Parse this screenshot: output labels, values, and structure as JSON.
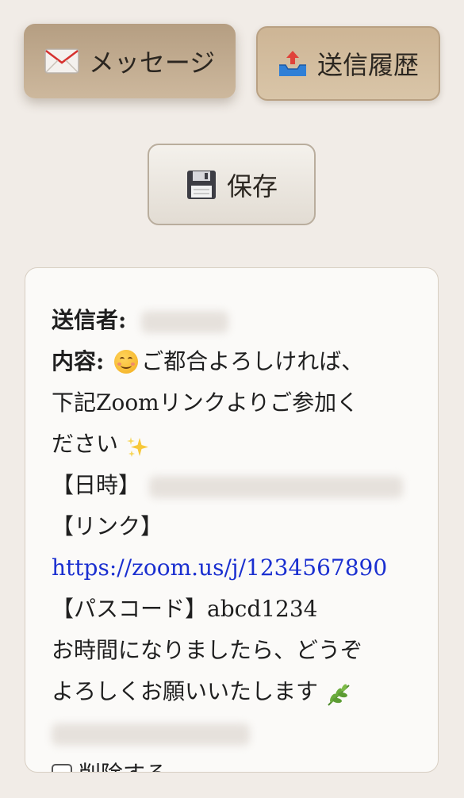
{
  "toolbar": {
    "message_label": "メッセージ",
    "history_label": "送信履歴",
    "save_label": "保存"
  },
  "message": {
    "sender_label": "送信者:",
    "content_label": "内容:",
    "line1": "ご都合よろしければ、",
    "line2": "下記Zoomリンクよりご参加く",
    "line3": "ださい",
    "datetime_label": "【日時】",
    "link_label": "【リンク】",
    "link_url": "https://zoom.us/j/1234567890",
    "passcode_label": "【パスコード】",
    "passcode_value": "abcd1234",
    "closing_line1": "お時間になりましたら、どうぞ",
    "closing_line2": "よろしくお願いいたします"
  },
  "delete": {
    "label": "削除する",
    "checked": false
  },
  "icons": {
    "message": "envelope-icon",
    "history": "outbox-tray-icon",
    "save": "floppy-disk-icon",
    "smile": "smiling-face-emoji",
    "sparkles": "sparkles-emoji",
    "leaf": "herb-emoji"
  },
  "colors": {
    "background": "#f1ece7",
    "message_button": "#c2ab8f",
    "history_button": "#d4bea0",
    "save_button": "#ebe6df",
    "card": "#fbfaf8",
    "link": "#1a2fd0"
  }
}
